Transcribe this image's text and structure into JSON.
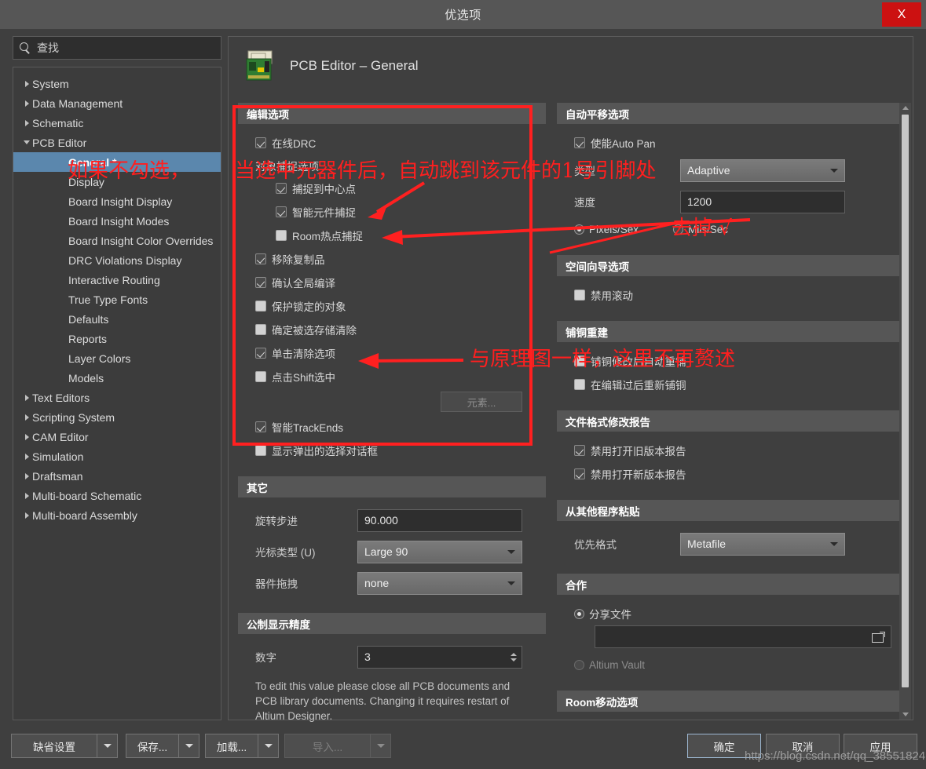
{
  "window": {
    "title": "优选项",
    "close_label": "X"
  },
  "search": {
    "placeholder": "查找",
    "icon": "search-icon"
  },
  "sidebar": {
    "items": [
      {
        "label": "System",
        "level": 1,
        "expandable": true,
        "expanded": false
      },
      {
        "label": "Data Management",
        "level": 1,
        "expandable": true,
        "expanded": false
      },
      {
        "label": "Schematic",
        "level": 1,
        "expandable": true,
        "expanded": false
      },
      {
        "label": "PCB Editor",
        "level": 1,
        "expandable": true,
        "expanded": true
      },
      {
        "label": "General *",
        "level": 2,
        "expandable": false,
        "selected": true
      },
      {
        "label": "Display",
        "level": 2,
        "expandable": false
      },
      {
        "label": "Board Insight Display",
        "level": 2,
        "expandable": false
      },
      {
        "label": "Board Insight Modes",
        "level": 2,
        "expandable": false
      },
      {
        "label": "Board Insight Color Overrides",
        "level": 2,
        "expandable": false
      },
      {
        "label": "DRC Violations Display",
        "level": 2,
        "expandable": false
      },
      {
        "label": "Interactive Routing",
        "level": 2,
        "expandable": false
      },
      {
        "label": "True Type Fonts",
        "level": 2,
        "expandable": false
      },
      {
        "label": "Defaults",
        "level": 2,
        "expandable": false
      },
      {
        "label": "Reports",
        "level": 2,
        "expandable": false
      },
      {
        "label": "Layer Colors",
        "level": 2,
        "expandable": false
      },
      {
        "label": "Models",
        "level": 2,
        "expandable": false
      },
      {
        "label": "Text Editors",
        "level": 1,
        "expandable": true,
        "expanded": false
      },
      {
        "label": "Scripting System",
        "level": 1,
        "expandable": true,
        "expanded": false
      },
      {
        "label": "CAM Editor",
        "level": 1,
        "expandable": true,
        "expanded": false
      },
      {
        "label": "Simulation",
        "level": 1,
        "expandable": true,
        "expanded": false
      },
      {
        "label": "Draftsman",
        "level": 1,
        "expandable": true,
        "expanded": false
      },
      {
        "label": "Multi-board Schematic",
        "level": 1,
        "expandable": true,
        "expanded": false
      },
      {
        "label": "Multi-board Assembly",
        "level": 1,
        "expandable": true,
        "expanded": false
      }
    ]
  },
  "page": {
    "title": "PCB Editor – General",
    "icon": "pcb-board-icon"
  },
  "editing_options": {
    "header": "编辑选项",
    "online_drc": {
      "label": "在线DRC",
      "checked": true
    },
    "snap_subhead": "对象捕捉选项",
    "snap_center": {
      "label": "捕捉到中心点",
      "checked": true
    },
    "snap_component": {
      "label": "智能元件捕捉",
      "checked": true
    },
    "snap_room_hotspot": {
      "label": "Room热点捕捉",
      "checked": false
    },
    "remove_duplicates": {
      "label": "移除复制品",
      "checked": true
    },
    "confirm_global_edit": {
      "label": "确认全局编译",
      "checked": true
    },
    "protect_locked": {
      "label": "保护锁定的对象",
      "checked": false
    },
    "confirm_selection_memory_clear": {
      "label": "确定被选存储清除",
      "checked": false
    },
    "click_clears_selection": {
      "label": "单击清除选项",
      "checked": true
    },
    "shift_click_to_select": {
      "label": "点击Shift选中",
      "checked": false
    },
    "smart_track_ends": {
      "label": "智能TrackEnds",
      "checked": true
    },
    "display_popup_select_dialog": {
      "label": "显示弹出的选择对话框",
      "checked": false
    },
    "primitives_button": "元素..."
  },
  "other": {
    "header": "其它",
    "rotation_step": {
      "label": "旋转步进",
      "value": "90.000"
    },
    "cursor_type": {
      "label": "光标类型 (U)",
      "value": "Large 90"
    },
    "comp_drag": {
      "label": "器件拖拽",
      "value": "none"
    }
  },
  "metric_precision": {
    "header": "公制显示精度",
    "digits": {
      "label": "数字",
      "value": "3"
    },
    "hint": "To edit this value please close all PCB documents and PCB library documents. Changing it requires restart of Altium Designer."
  },
  "autopan": {
    "header": "自动平移选项",
    "enable": {
      "label": "使能Auto Pan",
      "checked": true
    },
    "style": {
      "label": "类型",
      "value": "Adaptive"
    },
    "speed": {
      "label": "速度",
      "value": "1200"
    },
    "units": [
      {
        "label": "Pixels/Sex",
        "selected": true
      },
      {
        "label": "Mils/Sec",
        "selected": false
      }
    ]
  },
  "space_navigator": {
    "header": "空间向导选项",
    "disable_rollover": {
      "label": "禁用滚动",
      "checked": false
    }
  },
  "polygon_rebuild": {
    "header": "铺铜重建",
    "repour_after_edit": {
      "label": "铺铜修改后自动重铺",
      "checked": false
    },
    "repour_all_after_edit": {
      "label": "在编辑过后重新铺铜",
      "checked": false
    }
  },
  "file_format_report": {
    "header": "文件格式修改报告",
    "disable_old": {
      "label": "禁用打开旧版本报告",
      "checked": true
    },
    "disable_new": {
      "label": "禁用打开新版本报告",
      "checked": true
    }
  },
  "paste_from_other": {
    "header": "从其他程序粘贴",
    "preferred_format": {
      "label": "优先格式",
      "value": "Metafile"
    }
  },
  "collaboration": {
    "header": "合作",
    "shared_file": {
      "label": "分享文件",
      "selected": true,
      "path": ""
    },
    "altium_vault": {
      "label": "Altium Vault",
      "selected": false
    }
  },
  "room_move": {
    "header": "Room移动选项"
  },
  "footer": {
    "defaults": "缺省设置",
    "save": "保存...",
    "load": "加载...",
    "import": "导入...",
    "ok": "确定",
    "cancel": "取消",
    "apply": "应用",
    "watermark": "https://blog.csdn.net/qq_38551824"
  },
  "annotations": {
    "note1": "如果不勾选，",
    "note2": "当选中元器件后，自动跳到该元件的1号引脚处",
    "note3": "去掉 √",
    "note4": "与原理图一样，这里不再赘述"
  },
  "colors": {
    "accent_red": "#ff2020",
    "selection_blue": "#5b87ad",
    "close_red": "#cc1111",
    "panel_bg": "#3f3f3f",
    "group_head": "#565656"
  }
}
